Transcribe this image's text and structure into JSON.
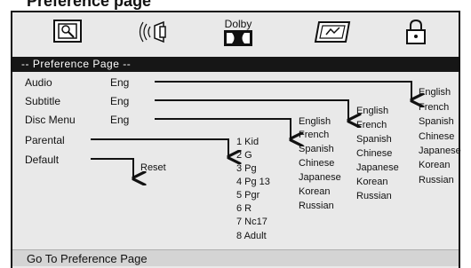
{
  "header": {
    "cut_title": "Preference page"
  },
  "toolbar": {
    "icons": [
      "settings-icon",
      "speaker-audio-icon",
      "dolby-logo-icon",
      "picture-icon",
      "lock-icon"
    ],
    "dolby_label": "Dolby"
  },
  "preference_bar": {
    "title": "-- Preference Page --"
  },
  "settings": [
    {
      "label": "Audio",
      "value": "Eng"
    },
    {
      "label": "Subtitle",
      "value": "Eng"
    },
    {
      "label": "Disc Menu",
      "value": "Eng"
    },
    {
      "label": "Parental",
      "value": ""
    },
    {
      "label": "Default",
      "value": ""
    }
  ],
  "default_option": "Reset",
  "parental_options": [
    "1 Kid",
    "2 G",
    "3 Pg",
    "4 Pg 13",
    "5 Pgr",
    "6 R",
    "7 Nc17",
    "8 Adult"
  ],
  "disc_menu_options": [
    "English",
    "French",
    "Spanish",
    "Chinese",
    "Japanese",
    "Korean",
    "Russian"
  ],
  "subtitle_options": [
    "English",
    "French",
    "Spanish",
    "Chinese",
    "Japanese",
    "Korean",
    "Russian"
  ],
  "audio_options": [
    "English",
    "French",
    "Spanish",
    "Chinese",
    "Japanese",
    "Korean",
    "Russian"
  ],
  "status_bar": {
    "text": "Go To Preference Page"
  }
}
